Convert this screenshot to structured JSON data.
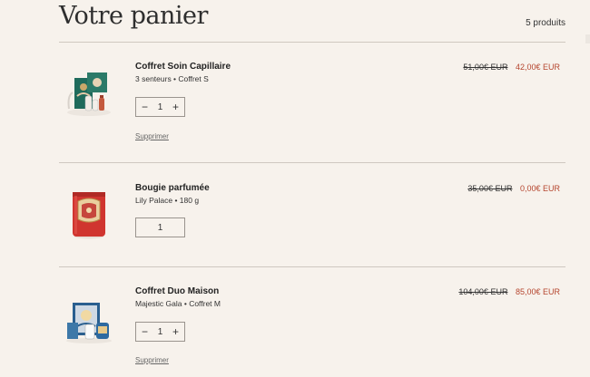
{
  "page": {
    "title": "Votre panier",
    "count": "5 produits",
    "remove_label": "Supprimer"
  },
  "items": [
    {
      "name": "Coffret Soin Capillaire",
      "variant": "3 senteurs • Coffret S",
      "quantity": "1",
      "old_price": "51,00€ EUR",
      "price": "42,00€ EUR",
      "editable_quantity": true,
      "image_icon": "hair-care-gift-box-image"
    },
    {
      "name": "Bougie parfumée",
      "variant": "Lily Palace • 180 g",
      "quantity": "1",
      "old_price": "35,00€ EUR",
      "price": "0,00€ EUR",
      "editable_quantity": false,
      "image_icon": "scented-candle-image"
    },
    {
      "name": "Coffret Duo Maison",
      "variant": "Majestic Gala • Coffret M",
      "quantity": "1",
      "old_price": "104,00€ EUR",
      "price": "85,00€ EUR",
      "editable_quantity": true,
      "image_icon": "home-duo-gift-box-image"
    }
  ],
  "colors": {
    "background": "#f7f2ec",
    "sale_price": "#b5452e",
    "divider": "#cfc8c0"
  }
}
